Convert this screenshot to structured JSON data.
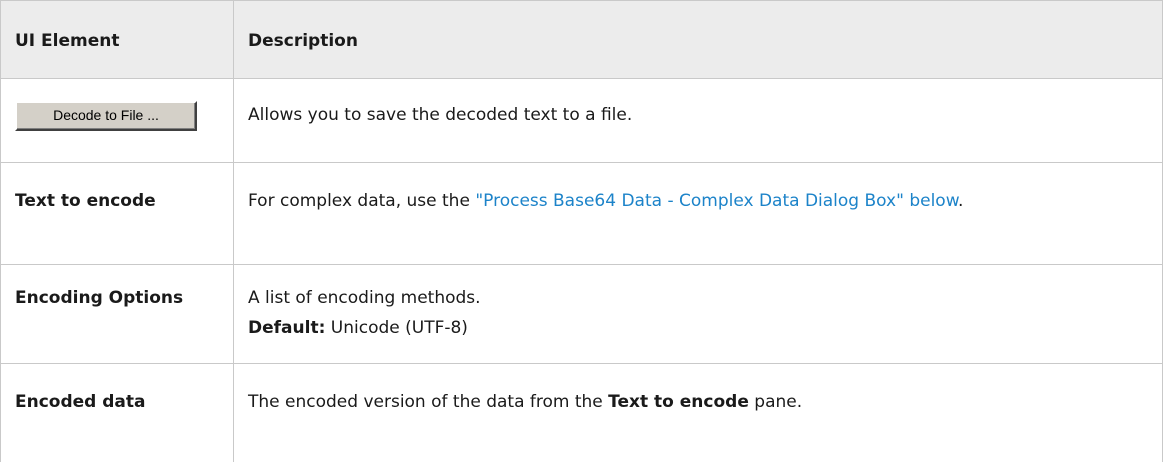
{
  "header": {
    "col1": "UI Element",
    "col2": "Description"
  },
  "rows": [
    {
      "button_label": "Decode to File ...",
      "description": "Allows you to save the decoded text to a file."
    },
    {
      "element": "Text to encode",
      "description_before": "For complex data, use the ",
      "link_text": "\"Process Base64 Data - Complex Data Dialog Box\" below",
      "description_after": "."
    },
    {
      "element": "Encoding Options",
      "description_line1": "A list of encoding methods.",
      "default_label": "Default:",
      "default_value": " Unicode (UTF-8)"
    },
    {
      "element": "Encoded data",
      "description_before": "The encoded version of the data from the ",
      "description_bold": "Text to encode",
      "description_after": " pane."
    }
  ],
  "colors": {
    "header_bg": "#ececec",
    "border": "#c9c9c9",
    "link": "#1c83c9",
    "button_face": "#d4d0c8"
  }
}
